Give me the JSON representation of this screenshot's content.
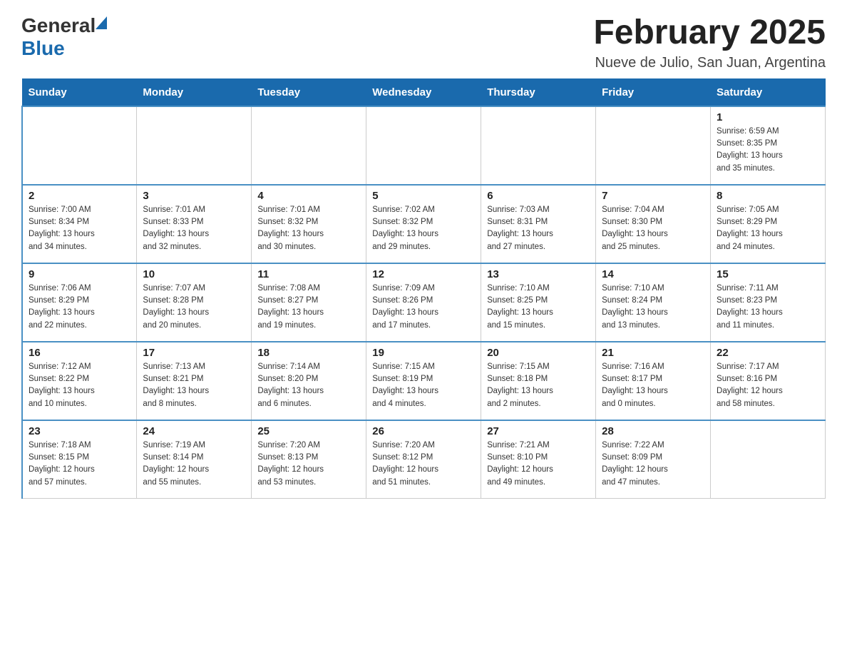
{
  "header": {
    "logo_general": "General",
    "logo_blue": "Blue",
    "month_title": "February 2025",
    "location": "Nueve de Julio, San Juan, Argentina"
  },
  "calendar": {
    "days_of_week": [
      "Sunday",
      "Monday",
      "Tuesday",
      "Wednesday",
      "Thursday",
      "Friday",
      "Saturday"
    ],
    "weeks": [
      {
        "days": [
          {
            "num": "",
            "info": ""
          },
          {
            "num": "",
            "info": ""
          },
          {
            "num": "",
            "info": ""
          },
          {
            "num": "",
            "info": ""
          },
          {
            "num": "",
            "info": ""
          },
          {
            "num": "",
            "info": ""
          },
          {
            "num": "1",
            "info": "Sunrise: 6:59 AM\nSunset: 8:35 PM\nDaylight: 13 hours\nand 35 minutes."
          }
        ]
      },
      {
        "days": [
          {
            "num": "2",
            "info": "Sunrise: 7:00 AM\nSunset: 8:34 PM\nDaylight: 13 hours\nand 34 minutes."
          },
          {
            "num": "3",
            "info": "Sunrise: 7:01 AM\nSunset: 8:33 PM\nDaylight: 13 hours\nand 32 minutes."
          },
          {
            "num": "4",
            "info": "Sunrise: 7:01 AM\nSunset: 8:32 PM\nDaylight: 13 hours\nand 30 minutes."
          },
          {
            "num": "5",
            "info": "Sunrise: 7:02 AM\nSunset: 8:32 PM\nDaylight: 13 hours\nand 29 minutes."
          },
          {
            "num": "6",
            "info": "Sunrise: 7:03 AM\nSunset: 8:31 PM\nDaylight: 13 hours\nand 27 minutes."
          },
          {
            "num": "7",
            "info": "Sunrise: 7:04 AM\nSunset: 8:30 PM\nDaylight: 13 hours\nand 25 minutes."
          },
          {
            "num": "8",
            "info": "Sunrise: 7:05 AM\nSunset: 8:29 PM\nDaylight: 13 hours\nand 24 minutes."
          }
        ]
      },
      {
        "days": [
          {
            "num": "9",
            "info": "Sunrise: 7:06 AM\nSunset: 8:29 PM\nDaylight: 13 hours\nand 22 minutes."
          },
          {
            "num": "10",
            "info": "Sunrise: 7:07 AM\nSunset: 8:28 PM\nDaylight: 13 hours\nand 20 minutes."
          },
          {
            "num": "11",
            "info": "Sunrise: 7:08 AM\nSunset: 8:27 PM\nDaylight: 13 hours\nand 19 minutes."
          },
          {
            "num": "12",
            "info": "Sunrise: 7:09 AM\nSunset: 8:26 PM\nDaylight: 13 hours\nand 17 minutes."
          },
          {
            "num": "13",
            "info": "Sunrise: 7:10 AM\nSunset: 8:25 PM\nDaylight: 13 hours\nand 15 minutes."
          },
          {
            "num": "14",
            "info": "Sunrise: 7:10 AM\nSunset: 8:24 PM\nDaylight: 13 hours\nand 13 minutes."
          },
          {
            "num": "15",
            "info": "Sunrise: 7:11 AM\nSunset: 8:23 PM\nDaylight: 13 hours\nand 11 minutes."
          }
        ]
      },
      {
        "days": [
          {
            "num": "16",
            "info": "Sunrise: 7:12 AM\nSunset: 8:22 PM\nDaylight: 13 hours\nand 10 minutes."
          },
          {
            "num": "17",
            "info": "Sunrise: 7:13 AM\nSunset: 8:21 PM\nDaylight: 13 hours\nand 8 minutes."
          },
          {
            "num": "18",
            "info": "Sunrise: 7:14 AM\nSunset: 8:20 PM\nDaylight: 13 hours\nand 6 minutes."
          },
          {
            "num": "19",
            "info": "Sunrise: 7:15 AM\nSunset: 8:19 PM\nDaylight: 13 hours\nand 4 minutes."
          },
          {
            "num": "20",
            "info": "Sunrise: 7:15 AM\nSunset: 8:18 PM\nDaylight: 13 hours\nand 2 minutes."
          },
          {
            "num": "21",
            "info": "Sunrise: 7:16 AM\nSunset: 8:17 PM\nDaylight: 13 hours\nand 0 minutes."
          },
          {
            "num": "22",
            "info": "Sunrise: 7:17 AM\nSunset: 8:16 PM\nDaylight: 12 hours\nand 58 minutes."
          }
        ]
      },
      {
        "days": [
          {
            "num": "23",
            "info": "Sunrise: 7:18 AM\nSunset: 8:15 PM\nDaylight: 12 hours\nand 57 minutes."
          },
          {
            "num": "24",
            "info": "Sunrise: 7:19 AM\nSunset: 8:14 PM\nDaylight: 12 hours\nand 55 minutes."
          },
          {
            "num": "25",
            "info": "Sunrise: 7:20 AM\nSunset: 8:13 PM\nDaylight: 12 hours\nand 53 minutes."
          },
          {
            "num": "26",
            "info": "Sunrise: 7:20 AM\nSunset: 8:12 PM\nDaylight: 12 hours\nand 51 minutes."
          },
          {
            "num": "27",
            "info": "Sunrise: 7:21 AM\nSunset: 8:10 PM\nDaylight: 12 hours\nand 49 minutes."
          },
          {
            "num": "28",
            "info": "Sunrise: 7:22 AM\nSunset: 8:09 PM\nDaylight: 12 hours\nand 47 minutes."
          },
          {
            "num": "",
            "info": ""
          }
        ]
      }
    ]
  }
}
